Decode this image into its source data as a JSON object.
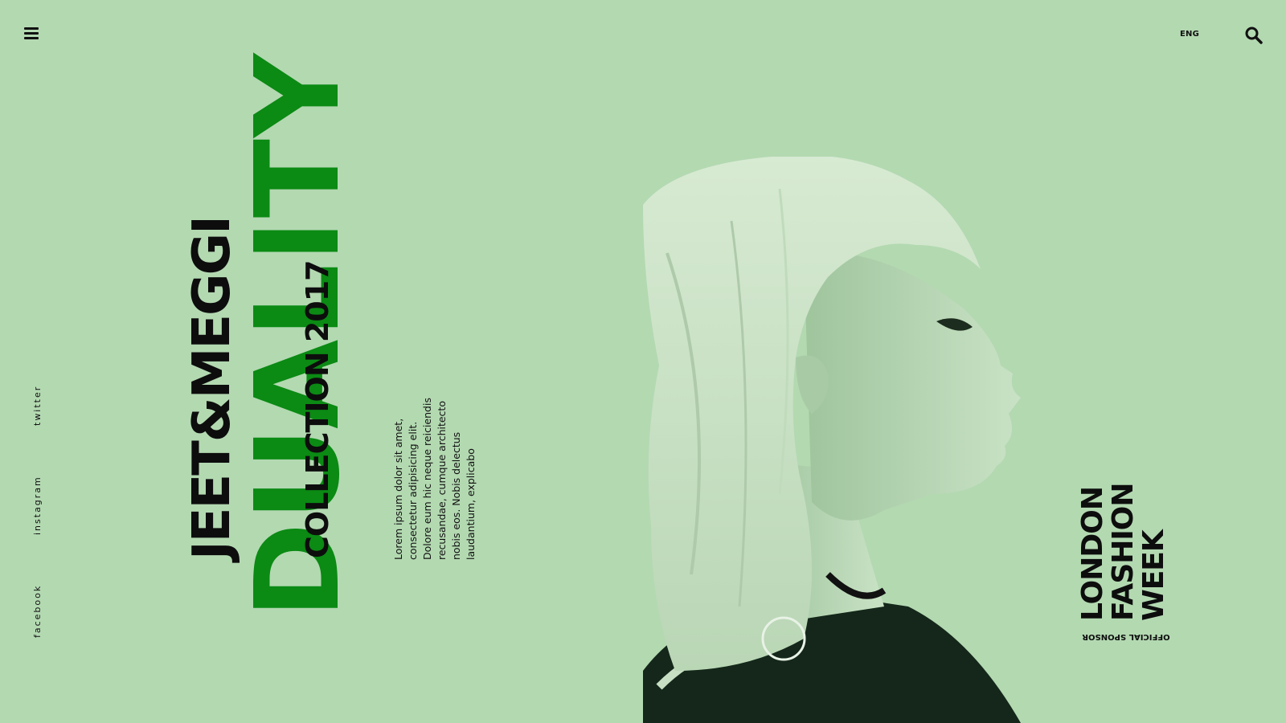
{
  "header": {
    "menu_icon": "hamburger-menu-icon",
    "language": "ENG",
    "search_icon": "search-icon"
  },
  "social": {
    "twitter": "twitter",
    "instagram": "instagram",
    "facebook": "facebook"
  },
  "hero": {
    "brand": "JEET&MEGGI",
    "headline": "DUALITY",
    "collection": "COLLECTION 2017",
    "description_lines": [
      "Lorem ipsum dolor sit amet,",
      "consectetur adipisicing elit.",
      "Dolore eum hic neque reiciendis",
      "recusandae, cumque architecto",
      "nobis eos. Nobis delectus",
      "laudantium, explicabo"
    ]
  },
  "sponsor": {
    "line1": "LONDON",
    "line2": "FASHION",
    "line3": "WEEK",
    "label": "OFFICIAL SPONSOR"
  },
  "colors": {
    "background": "#b3d9b1",
    "accent": "#0b8a14",
    "text": "#0d0d0d"
  }
}
